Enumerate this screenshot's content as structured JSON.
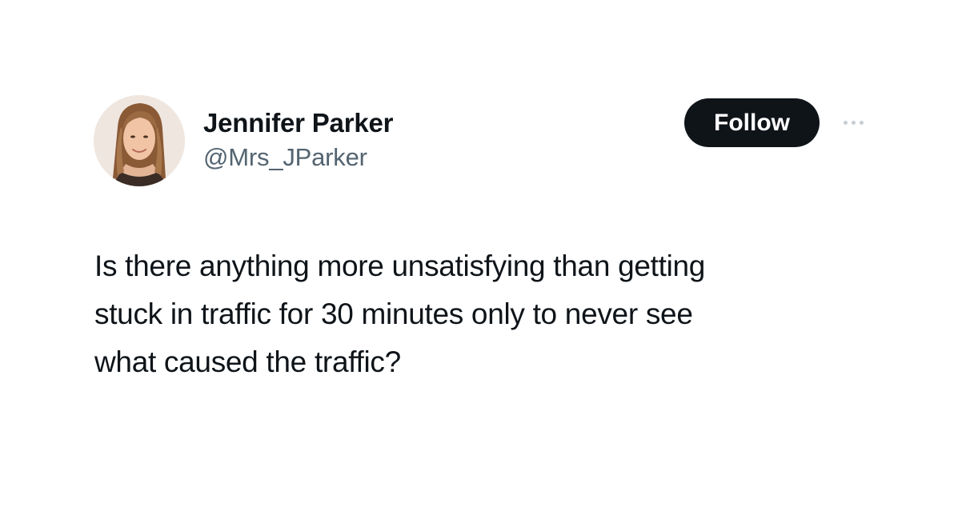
{
  "author": {
    "display_name": "Jennifer Parker",
    "handle": "@Mrs_JParker",
    "avatar_icon": "profile-photo"
  },
  "actions": {
    "follow_label": "Follow",
    "more_icon": "more-options-icon"
  },
  "tweet": {
    "lines": [
      "Is there anything more unsatisfying than getting",
      "stuck in traffic for 30 minutes only to never see",
      "what caused the traffic?"
    ]
  },
  "colors": {
    "text_primary": "#0f1419",
    "text_secondary": "#536471",
    "follow_bg": "#0f1419",
    "follow_text": "#ffffff",
    "background": "#ffffff"
  }
}
